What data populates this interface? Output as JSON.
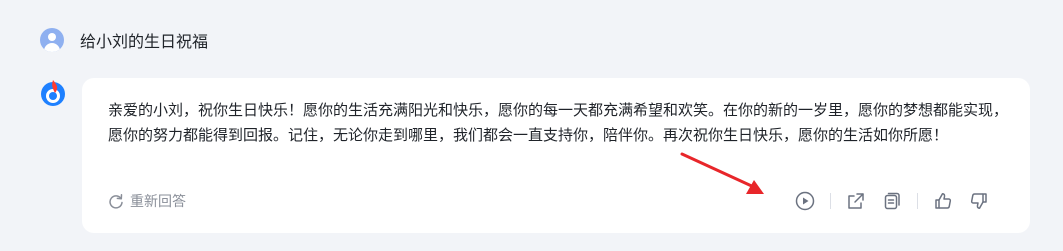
{
  "user": {
    "avatar_icon": "user-avatar-icon",
    "message": "给小刘的生日祝福"
  },
  "bot": {
    "logo_icon": "bot-logo-icon",
    "answer": "亲爱的小刘，祝你生日快乐！愿你的生活充满阳光和快乐，愿你的每一天都充满希望和欢笑。在你的新的一岁里，愿你的梦想都能实现，愿你的努力都能得到回报。记住，无论你走到哪里，我们都会一直支持你，陪伴你。再次祝你生日快乐，愿你的生活如你所愿！",
    "regenerate_label": "重新回答"
  },
  "actions": {
    "icons": [
      "play-icon",
      "share-icon",
      "copy-icon",
      "thumbs-up-icon",
      "thumbs-down-icon"
    ]
  },
  "annotation": {
    "color": "#e8262a",
    "points_to": "play-button"
  },
  "colors": {
    "background": "#f2f4f8",
    "card": "#ffffff",
    "text": "#1f2329",
    "muted": "#8a8f99",
    "avatar": "#8fb0f0"
  }
}
